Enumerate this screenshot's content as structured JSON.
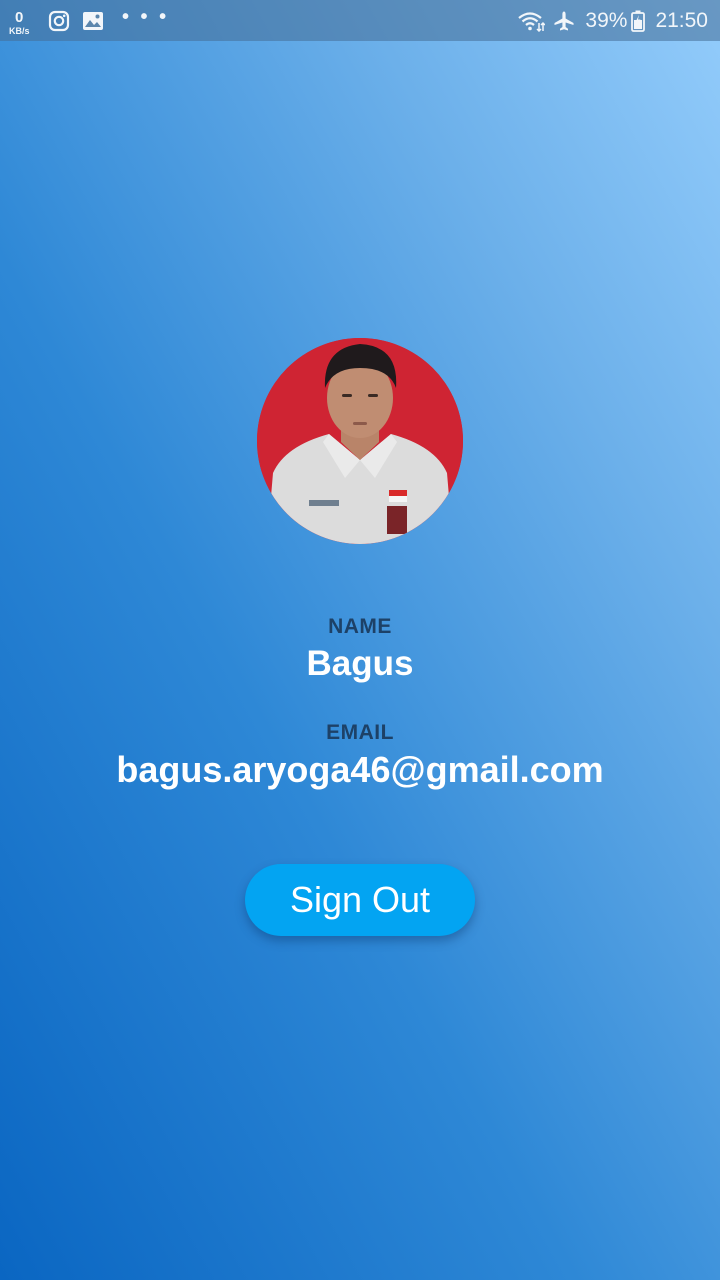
{
  "status_bar": {
    "net_speed_value": "0",
    "net_speed_unit": "KB/s",
    "left_icons": [
      "instagram-icon",
      "gallery-icon"
    ],
    "more_indicator": "• • •",
    "right_icons": [
      "wifi-icon",
      "airplane-mode-icon",
      "battery-icon"
    ],
    "battery_percent": "39%",
    "time": "21:50"
  },
  "profile": {
    "avatar_icon": "profile-photo",
    "name_label": "NAME",
    "name_value": "Bagus",
    "email_label": "EMAIL",
    "email_value": "bagus.aryoga46@gmail.com"
  },
  "actions": {
    "sign_out_label": "Sign Out"
  },
  "colors": {
    "button": "#03a4f2",
    "label": "#1d4167",
    "gradient_top": "#93ccfb",
    "gradient_bottom": "#0a66c2"
  }
}
